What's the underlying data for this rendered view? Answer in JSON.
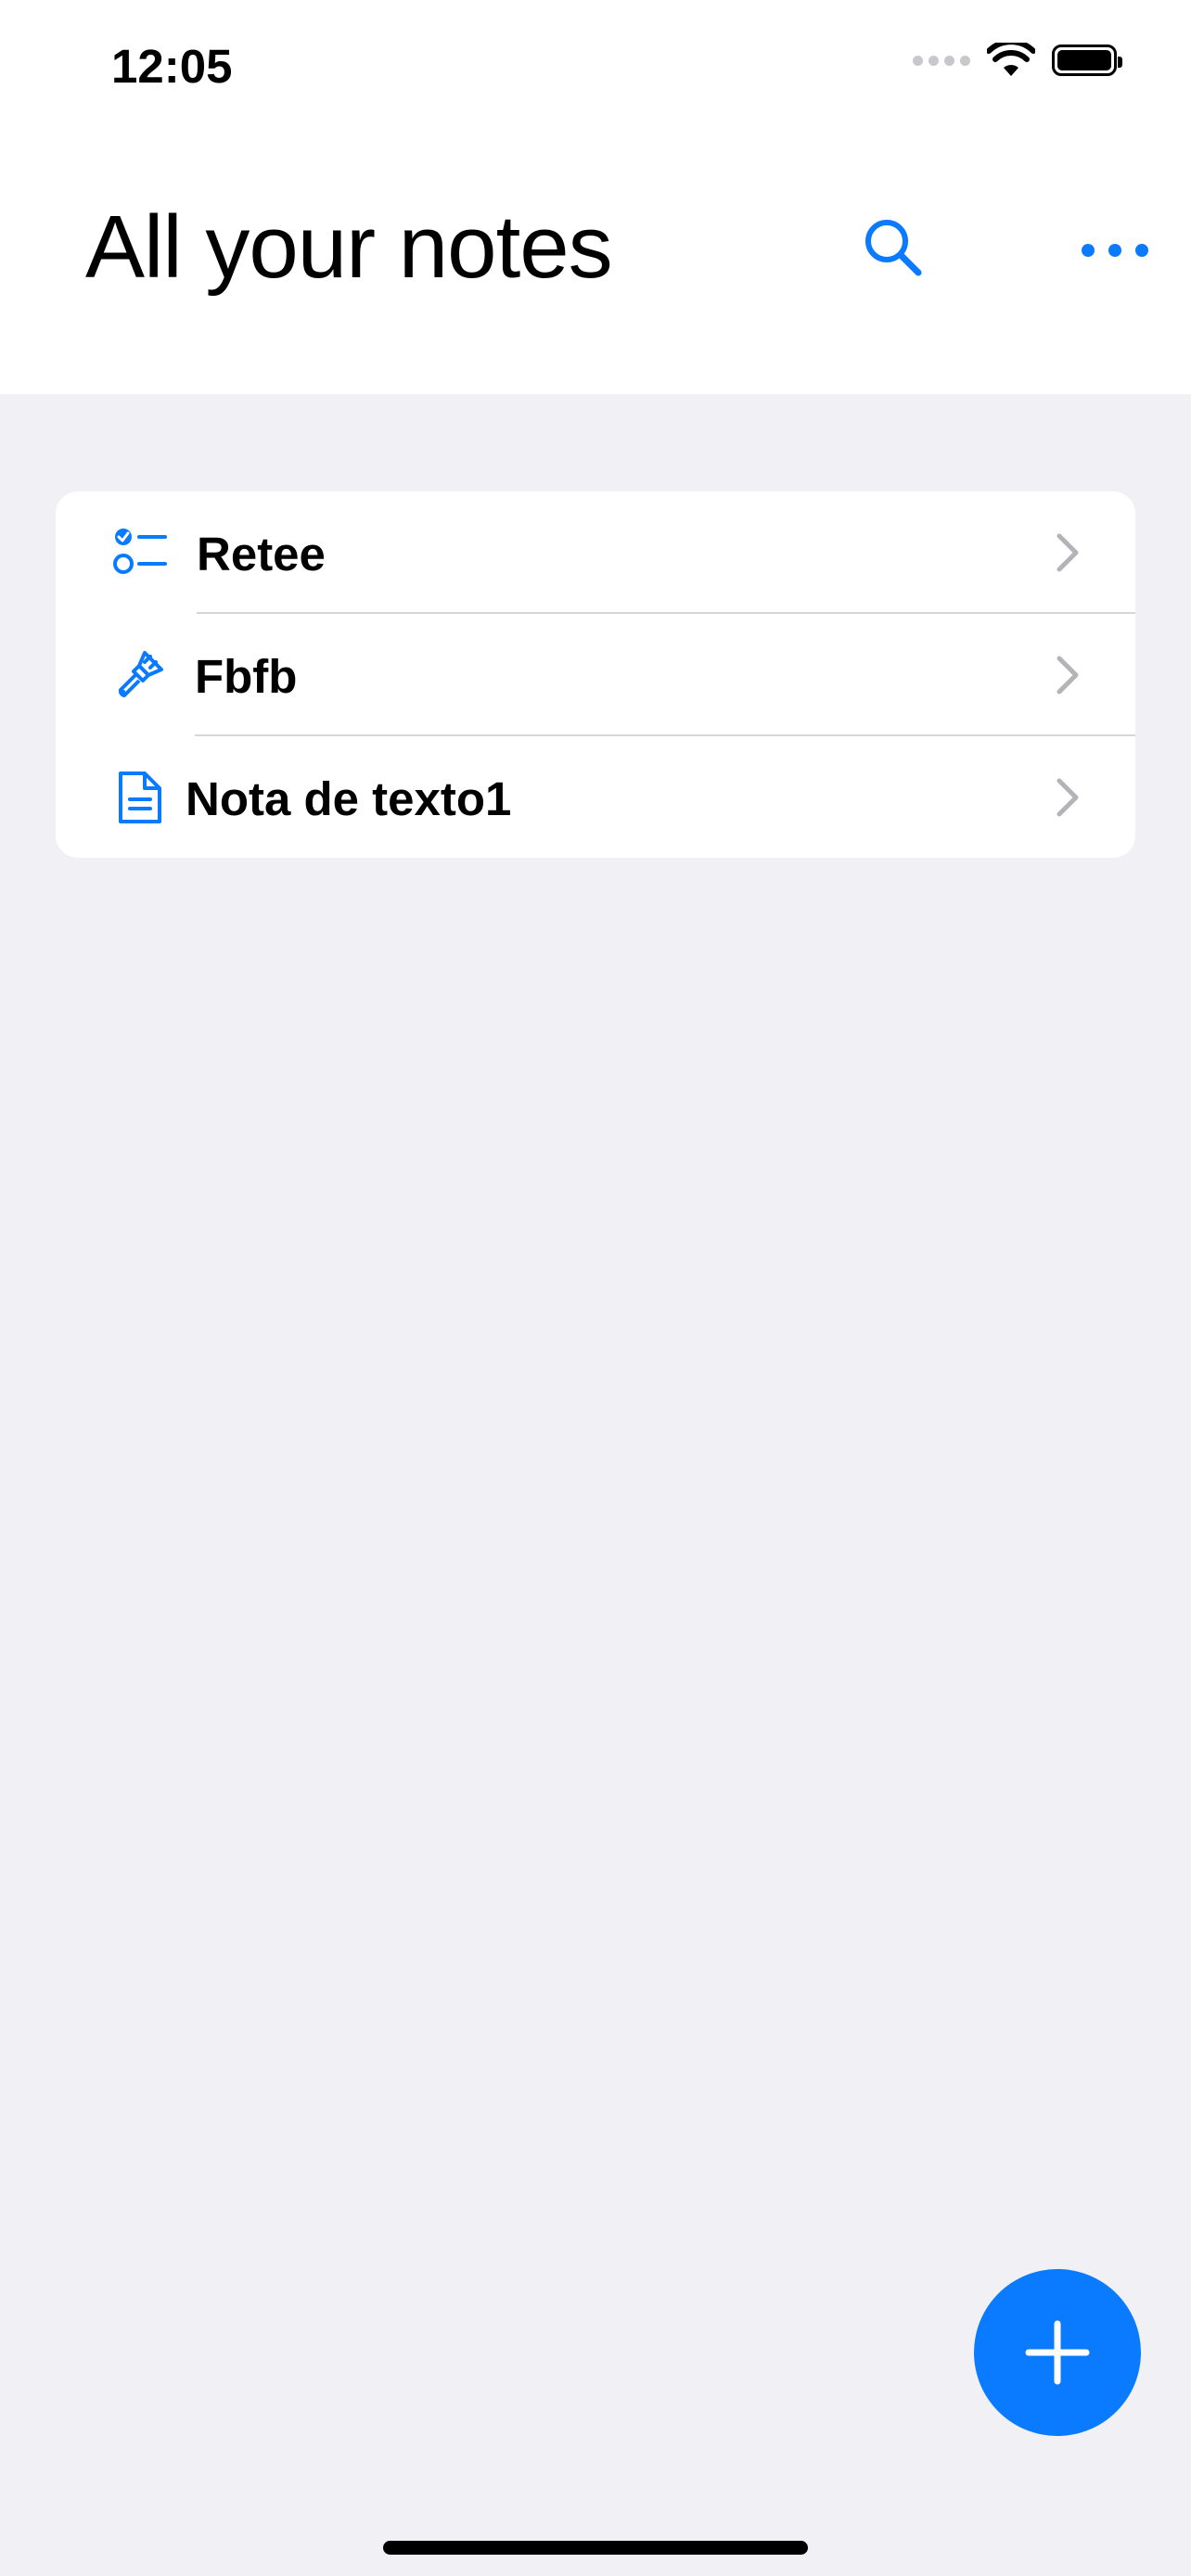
{
  "status_bar": {
    "time": "12:05"
  },
  "header": {
    "title": "All your notes"
  },
  "icons": {
    "search": "magnifying-glass",
    "more": "ellipsis",
    "add": "plus",
    "accent": "#0a7aff"
  },
  "notes": [
    {
      "title": "Retee",
      "icon": "checklist-icon"
    },
    {
      "title": "Fbfb",
      "icon": "paintbrush-icon"
    },
    {
      "title": "Nota de texto1",
      "icon": "document-icon"
    }
  ]
}
